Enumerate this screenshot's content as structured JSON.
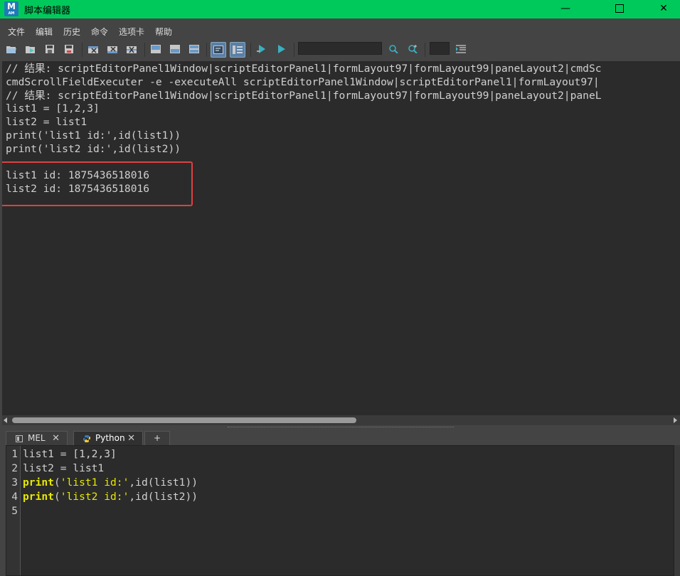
{
  "window": {
    "title": "脚本编辑器",
    "app_icon_letter": "M",
    "app_icon_sub": "AM",
    "minimize_glyph": "—",
    "close_glyph": "✕",
    "accent_color": "#00c95b"
  },
  "menu": [
    "文件",
    "编辑",
    "历史",
    "命令",
    "选项卡",
    "帮助"
  ],
  "toolbar": {
    "search_value": "",
    "icons": [
      "open-script-icon",
      "source-script-icon",
      "save-script-icon",
      "save-script-to-shelf-icon",
      "clear-history-icon",
      "clear-input-icon",
      "clear-all-icon",
      "show-history-icon",
      "show-input-icon",
      "show-both-icon",
      "echo-all-commands-icon",
      "show-line-numbers-icon",
      "execute-selected-icon",
      "execute-all-icon",
      "search-icon",
      "find-next-icon",
      "indent-icon"
    ]
  },
  "output": {
    "lines": [
      "// 结果: scriptEditorPanel1Window|scriptEditorPanel1|formLayout97|formLayout99|paneLayout2|cmdSc",
      "cmdScrollFieldExecuter -e -executeAll scriptEditorPanel1Window|scriptEditorPanel1|formLayout97|",
      "// 结果: scriptEditorPanel1Window|scriptEditorPanel1|formLayout97|formLayout99|paneLayout2|paneL",
      "list1 = [1,2,3]",
      "list2 = list1",
      "print('list1 id:',id(list1))",
      "print('list2 id:',id(list2))",
      "",
      "list1 id: 1875436518016",
      "list2 id: 1875436518016"
    ],
    "highlight_color": "#e04040"
  },
  "tabs": [
    {
      "label": "MEL",
      "close": "✕",
      "active": false
    },
    {
      "label": "Python",
      "close": "✕",
      "active": true
    },
    {
      "label": "+"
    }
  ],
  "editor": {
    "line_numbers": [
      "1",
      "2",
      "3",
      "4",
      "5"
    ],
    "code": {
      "l1": "list1 = [1,2,3]",
      "l2": "list2 = list1",
      "l3_kw": "print",
      "l3_a": "(",
      "l3_str": "'list1 id:'",
      "l3_b": ",id(list1))",
      "l4_kw": "print",
      "l4_a": "(",
      "l4_str": "'list2 id:'",
      "l4_b": ",id(list2))"
    },
    "keyword_color": "#e6e800"
  }
}
